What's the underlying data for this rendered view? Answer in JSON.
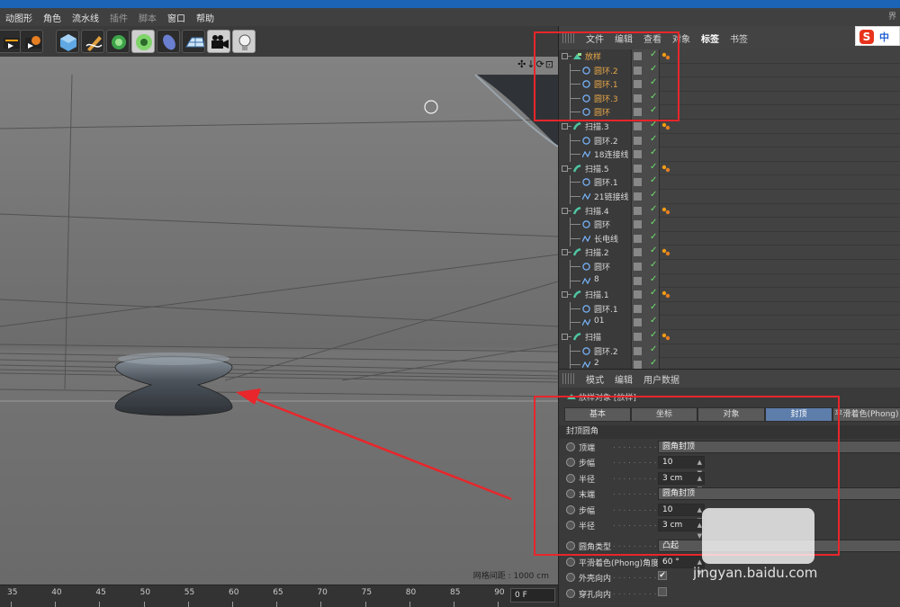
{
  "menubar": {
    "items": [
      {
        "label": "动图形",
        "dim": false
      },
      {
        "label": "角色",
        "dim": false
      },
      {
        "label": "流水线",
        "dim": false
      },
      {
        "label": "插件",
        "dim": true
      },
      {
        "label": "脚本",
        "dim": true
      },
      {
        "label": "窗口",
        "dim": false
      },
      {
        "label": "帮助",
        "dim": false
      }
    ],
    "corner_text": "界"
  },
  "toolbar": {
    "tools": [
      "render-view-icon",
      "render-settings-icon",
      "cube-icon",
      "pen-spline-icon",
      "subdivision-icon",
      "array-gear-icon",
      "deformer-icon",
      "floor-grid-icon",
      "camera-icon",
      "light-bulb-icon"
    ]
  },
  "viewport": {
    "tools": "✣↓⟳⊡",
    "grid_label": "网格间距 : 1000 cm"
  },
  "timeline": {
    "ticks": [
      "35",
      "40",
      "45",
      "50",
      "55",
      "60",
      "65",
      "70",
      "75",
      "80",
      "85",
      "90"
    ],
    "frame": "0 F"
  },
  "object_manager": {
    "menus": [
      {
        "label": "文件",
        "active": false
      },
      {
        "label": "编辑",
        "active": false
      },
      {
        "label": "查看",
        "active": false
      },
      {
        "label": "对象",
        "active": false
      },
      {
        "label": "标签",
        "active": true
      },
      {
        "label": "书签",
        "active": false
      }
    ],
    "ime_label": "中",
    "ime_logo": "S",
    "rows": [
      {
        "name": "放样",
        "level": 0,
        "type": "loft",
        "highlight": true,
        "tag": true
      },
      {
        "name": "圆环.2",
        "level": 1,
        "type": "circle",
        "highlight": true,
        "tag": false
      },
      {
        "name": "圆环.1",
        "level": 1,
        "type": "circle",
        "highlight": true,
        "tag": false
      },
      {
        "name": "圆环.3",
        "level": 1,
        "type": "circle",
        "highlight": true,
        "tag": false
      },
      {
        "name": "圆环",
        "level": 1,
        "type": "circle",
        "highlight": true,
        "tag": false
      },
      {
        "name": "扫描.3",
        "level": 0,
        "type": "sweep",
        "highlight": false,
        "tag": true
      },
      {
        "name": "圆环.2",
        "level": 1,
        "type": "circle",
        "highlight": false,
        "tag": false
      },
      {
        "name": "18连接线",
        "level": 1,
        "type": "spline",
        "highlight": false,
        "tag": false
      },
      {
        "name": "扫描.5",
        "level": 0,
        "type": "sweep",
        "highlight": false,
        "tag": true
      },
      {
        "name": "圆环.1",
        "level": 1,
        "type": "circle",
        "highlight": false,
        "tag": false
      },
      {
        "name": "21链接线",
        "level": 1,
        "type": "spline",
        "highlight": false,
        "tag": false
      },
      {
        "name": "扫描.4",
        "level": 0,
        "type": "sweep",
        "highlight": false,
        "tag": true
      },
      {
        "name": "圆环",
        "level": 1,
        "type": "circle",
        "highlight": false,
        "tag": false
      },
      {
        "name": "长电线",
        "level": 1,
        "type": "spline",
        "highlight": false,
        "tag": false
      },
      {
        "name": "扫描.2",
        "level": 0,
        "type": "sweep",
        "highlight": false,
        "tag": true
      },
      {
        "name": "圆环",
        "level": 1,
        "type": "circle",
        "highlight": false,
        "tag": false
      },
      {
        "name": "8",
        "level": 1,
        "type": "spline",
        "highlight": false,
        "tag": false
      },
      {
        "name": "扫描.1",
        "level": 0,
        "type": "sweep",
        "highlight": false,
        "tag": true
      },
      {
        "name": "圆环.1",
        "level": 1,
        "type": "circle",
        "highlight": false,
        "tag": false
      },
      {
        "name": "01",
        "level": 1,
        "type": "spline",
        "highlight": false,
        "tag": false
      },
      {
        "name": "扫描",
        "level": 0,
        "type": "sweep",
        "highlight": false,
        "tag": true
      },
      {
        "name": "圆环.2",
        "level": 1,
        "type": "circle",
        "highlight": false,
        "tag": false
      },
      {
        "name": "2",
        "level": 1,
        "type": "spline",
        "highlight": false,
        "tag": false
      }
    ]
  },
  "attribute_manager": {
    "menus": [
      "模式",
      "编辑",
      "用户数据"
    ],
    "object_title": "放样对象 [放样]",
    "tabs": [
      {
        "label": "基本",
        "active": false
      },
      {
        "label": "坐标",
        "active": false
      },
      {
        "label": "对象",
        "active": false
      },
      {
        "label": "封顶",
        "active": true
      },
      {
        "label": "平滑着色(Phong)",
        "active": false
      }
    ],
    "section": "封顶圆角",
    "props": [
      {
        "label": "顶端",
        "kind": "combo",
        "value": "圆角封顶"
      },
      {
        "label": "步幅",
        "kind": "num",
        "value": "10"
      },
      {
        "label": "半径",
        "kind": "num",
        "value": "3 cm"
      },
      {
        "label": "末端",
        "kind": "combo",
        "value": "圆角封顶"
      },
      {
        "label": "步幅",
        "kind": "num",
        "value": "10"
      },
      {
        "label": "半径",
        "kind": "num",
        "value": "3 cm"
      },
      {
        "label": "圆角类型",
        "kind": "combo",
        "value": "凸起",
        "gap": true
      },
      {
        "label": "平滑着色(Phong)角度",
        "kind": "num",
        "value": "60 °"
      },
      {
        "label": "外壳向内",
        "kind": "check",
        "value": "✔"
      },
      {
        "label": "穿孔向内",
        "kind": "check",
        "value": ""
      }
    ]
  },
  "watermark": {
    "text": "jingyan.baidu.com"
  },
  "colors": {
    "highlight_name": "#e9a84a",
    "check_green": "#6ee06e",
    "annotation_red": "#e8262b",
    "active_tab": "#5d7dab"
  }
}
